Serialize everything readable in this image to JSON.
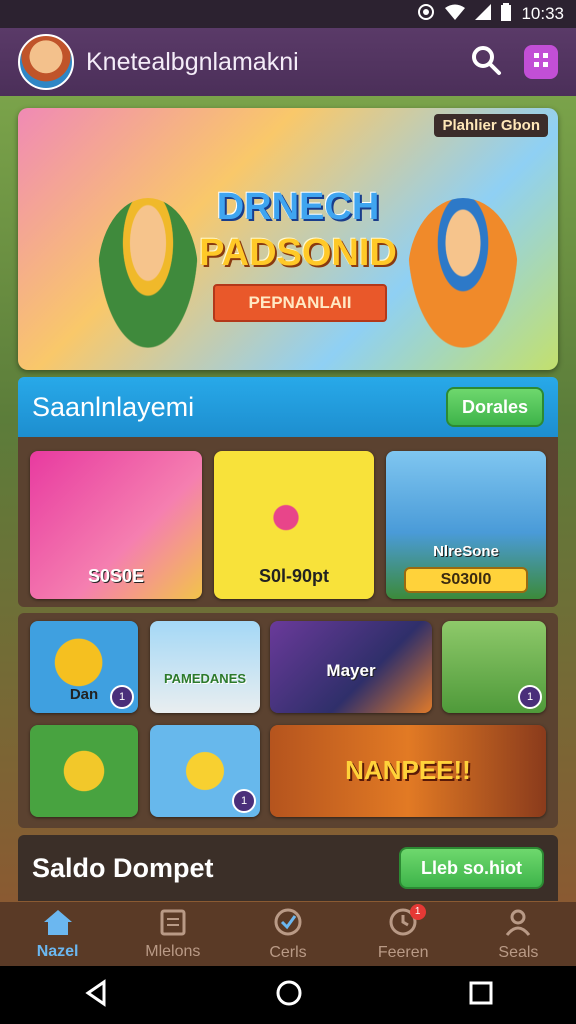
{
  "status_bar": {
    "time": "10:33"
  },
  "header": {
    "title": "Knetealbgnlamakni"
  },
  "hero": {
    "tag": "Plahlier Gbon",
    "title_line1": "DRNECH",
    "title_line2": "PADSONID",
    "ribbon": "PEPNANLAII"
  },
  "section1": {
    "title": "Saanlnlayemi",
    "button": "Dorales",
    "tiles": [
      {
        "label": "S0S0E"
      },
      {
        "label": "S0l-90pt"
      },
      {
        "label": "NlreSone",
        "pill": "S030l0"
      }
    ]
  },
  "section2": {
    "tiles": [
      {
        "label": "Dan",
        "badge": "1"
      },
      {
        "label": "PAMEDANES"
      },
      {
        "label": "Mayer"
      },
      {
        "label": "",
        "badge": "1"
      },
      {
        "label": ""
      },
      {
        "label": "",
        "badge": "1"
      },
      {
        "label": "NANPEE!!"
      }
    ]
  },
  "wallet": {
    "title": "Saldo Dompet",
    "button": "Lleb so.hiot"
  },
  "bottom_nav": [
    {
      "label": "Nazel",
      "icon": "home-icon"
    },
    {
      "label": "Mlelons",
      "icon": "document-icon"
    },
    {
      "label": "Cerls",
      "icon": "check-shield-icon"
    },
    {
      "label": "Feeren",
      "icon": "clock-icon",
      "badge": "1"
    },
    {
      "label": "Seals",
      "icon": "user-icon"
    }
  ],
  "colors": {
    "accent": "#1d8ecf",
    "green": "#3eb44a",
    "nav_active": "#6bb7f0"
  }
}
